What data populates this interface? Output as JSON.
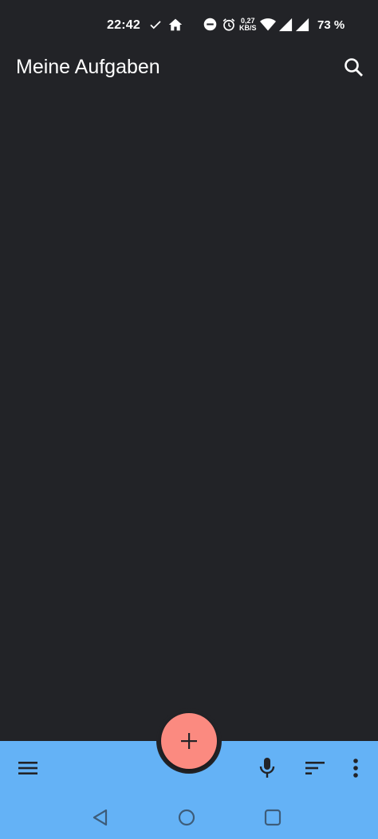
{
  "status_bar": {
    "time": "22:42",
    "net_speed_value": "0,27",
    "net_speed_unit": "KB/S",
    "battery": "73 %"
  },
  "app_bar": {
    "title": "Meine Aufgaben"
  },
  "colors": {
    "background": "#222327",
    "bottom_bar": "#64b2f6",
    "fab": "#fb8a80"
  },
  "icons": {
    "status": [
      "check-icon",
      "home-icon",
      "do-not-disturb-icon",
      "alarm-icon",
      "wifi-icon",
      "signal-icon",
      "signal-icon"
    ],
    "app_bar": [
      "search-icon"
    ],
    "bottom_bar": [
      "menu-icon",
      "add-icon",
      "mic-icon",
      "sort-icon",
      "more-vert-icon"
    ],
    "nav": [
      "back-icon",
      "home-circle-icon",
      "recents-icon"
    ]
  }
}
